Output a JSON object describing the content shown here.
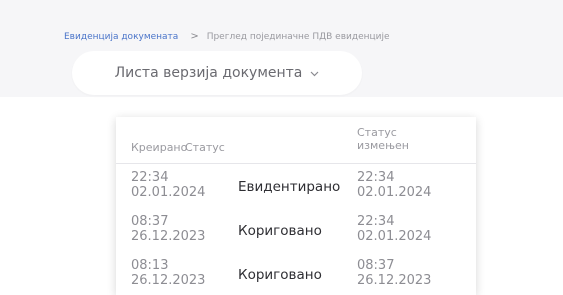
{
  "breadcrumb": {
    "root": "Евиденција докумената",
    "separator": ">",
    "current": "Преглед појединачне ПДВ евиденције"
  },
  "version_dropdown": {
    "label": "Листа верзија документа",
    "icon": "chevron-down-icon"
  },
  "versions_table": {
    "columns": {
      "created": "Креирано",
      "status": "Статус",
      "status_changed": "Статус\nизмењен"
    },
    "rows": [
      {
        "created_time": "22:34",
        "created_date": "02.01.2024",
        "status": "Евидентирано",
        "changed_time": "22:34",
        "changed_date": "02.01.2024"
      },
      {
        "created_time": "08:37",
        "created_date": "26.12.2023",
        "status": "Кориговано",
        "changed_time": "22:34",
        "changed_date": "02.01.2024"
      },
      {
        "created_time": "08:13",
        "created_date": "26.12.2023",
        "status": "Кориговано",
        "changed_time": "08:37",
        "changed_date": "26.12.2023"
      }
    ]
  },
  "colors": {
    "link": "#4a74c9",
    "top_band": "#f6f6f8",
    "muted_text": "#8d8d93",
    "status_text": "#2e2e33"
  }
}
